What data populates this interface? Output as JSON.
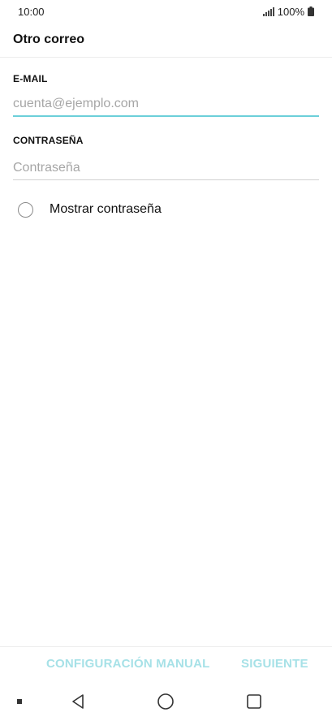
{
  "status_bar": {
    "time": "10:00",
    "battery": "100%",
    "icons": [
      "signal-icon",
      "battery-icon"
    ]
  },
  "header": {
    "title": "Otro correo"
  },
  "form": {
    "email": {
      "label": "E-MAIL",
      "value": "",
      "placeholder": "cuenta@ejemplo.com"
    },
    "password": {
      "label": "CONTRASEÑA",
      "value": "",
      "placeholder": "Contraseña"
    },
    "show_password": {
      "label": "Mostrar contraseña",
      "checked": false
    }
  },
  "actions": {
    "manual_label": "CONFIGURACIÓN MANUAL",
    "next_label": "SIGUIENTE"
  },
  "nav": {
    "icons": [
      "dot-icon",
      "back-icon",
      "home-icon",
      "recent-apps-icon"
    ]
  },
  "colors": {
    "accent": "#6ccfd9",
    "action_disabled": "#a6e1e7",
    "placeholder": "#a6a6a6"
  }
}
